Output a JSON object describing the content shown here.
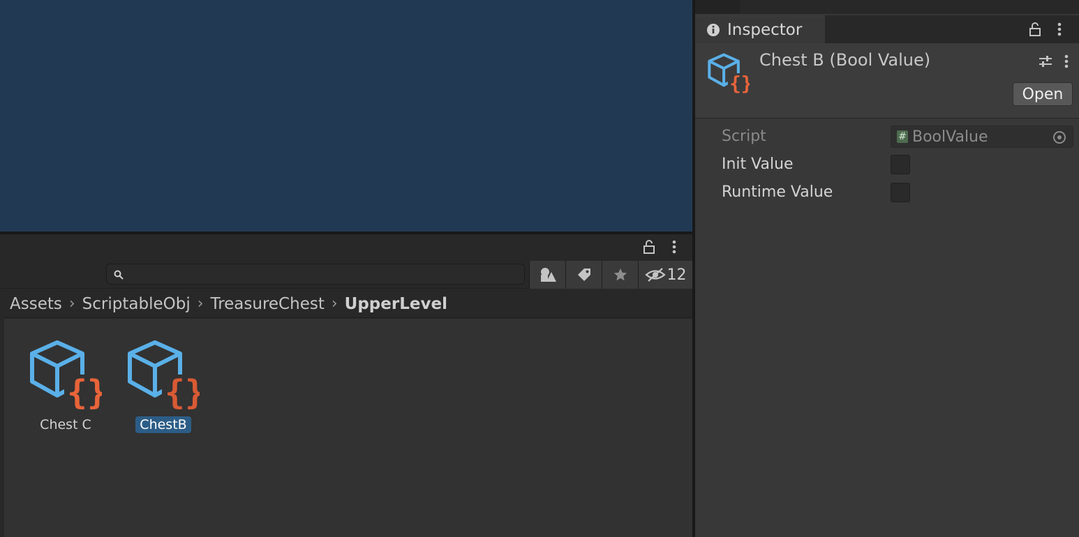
{
  "scene": {
    "bg": "#223953"
  },
  "project": {
    "toolbar": {
      "search_placeholder": "",
      "hidden_count": "12"
    },
    "breadcrumb": [
      "Assets",
      "ScriptableObj",
      "TreasureChest",
      "UpperLevel"
    ],
    "assets": [
      {
        "label": "Chest C",
        "selected": false
      },
      {
        "label": "ChestB",
        "selected": true
      }
    ]
  },
  "inspector": {
    "tab_label": "Inspector",
    "title": "Chest B (Bool Value)",
    "open_label": "Open",
    "properties": {
      "script_label": "Script",
      "script_value": "BoolValue",
      "init_label": "Init Value",
      "runtime_label": "Runtime Value"
    }
  },
  "colors": {
    "selection": "#2c5d87",
    "cube_blue": "#5ab0e8",
    "brace_orange": "#e8643a"
  }
}
